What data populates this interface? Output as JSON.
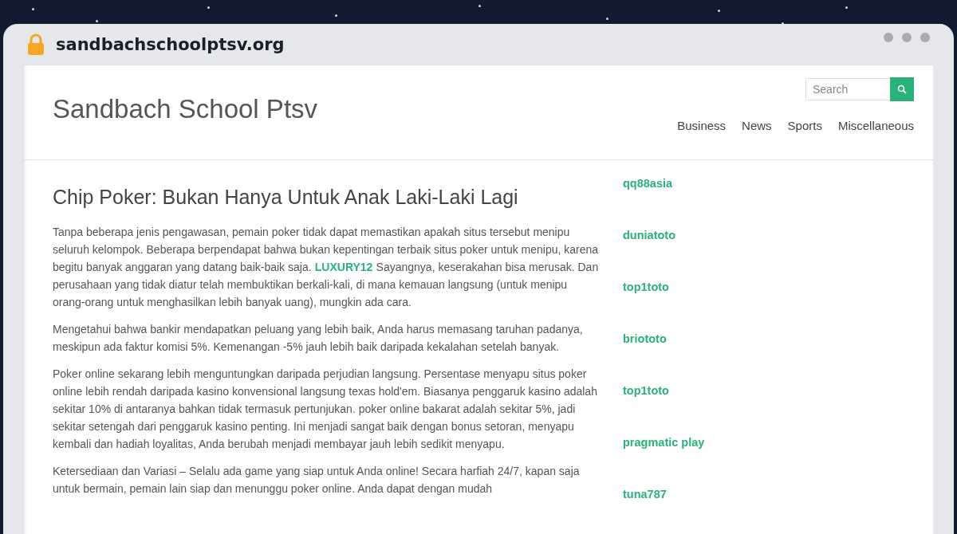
{
  "browser": {
    "url": "sandbachschoolptsv.org"
  },
  "site": {
    "title": "Sandbach School Ptsv"
  },
  "search": {
    "placeholder": "Search"
  },
  "nav": [
    {
      "label": "Business"
    },
    {
      "label": "News"
    },
    {
      "label": "Sports"
    },
    {
      "label": "Miscellaneous"
    }
  ],
  "article": {
    "title": "Chip Poker: Bukan Hanya Untuk Anak Laki-Laki Lagi",
    "paragraphs": [
      {
        "before": "Tanpa beberapa jenis pengawasan, pemain poker tidak dapat memastikan apakah situs tersebut menipu seluruh kelompok. Beberapa berpendapat bahwa bukan kepentingan terbaik situs poker untuk menipu, karena begitu banyak anggaran yang datang baik-baik saja.",
        "link": "LUXURY12",
        "after": "Sayangnya, keserakahan bisa merusak. Dan perusahaan yang tidak diatur telah membuktikan berkali-kali, di mana kemauan langsung (untuk menipu orang-orang untuk menghasilkan lebih banyak uang), mungkin ada cara."
      },
      {
        "before": "Mengetahui bahwa bankir mendapatkan peluang yang lebih baik, Anda harus memasang taruhan padanya, meskipun ada faktur komisi 5%. Kemenangan -5% jauh lebih baik daripada kekalahan setelah banyak."
      },
      {
        "before": "Poker online sekarang lebih menguntungkan daripada perjudian langsung. Persentase menyapu situs poker online lebih rendah daripada kasino konvensional langsung texas hold'em. Biasanya penggaruk kasino adalah sekitar 10% di antaranya bahkan tidak termasuk pertunjukan. poker online bakarat adalah sekitar 5%, jadi sekitar setengah dari penggaruk kasino penting. Ini menjadi sangat baik dengan bonus setoran, menyapu kembali dan hadiah loyalitas, Anda berubah menjadi membayar jauh lebih sedikit menyapu."
      },
      {
        "before": "Ketersediaan dan Variasi – Selalu ada game yang siap untuk Anda online! Secara harfiah 24/7, kapan saja untuk bermain, pemain lain siap dan menunggu poker online. Anda dapat dengan mudah"
      }
    ]
  },
  "sidebar_links": [
    {
      "label": "qq88asia"
    },
    {
      "label": "duniatoto"
    },
    {
      "label": "top1toto"
    },
    {
      "label": "briototo"
    },
    {
      "label": "top1toto"
    },
    {
      "label": "pragmatic play"
    },
    {
      "label": "tuna787"
    }
  ]
}
